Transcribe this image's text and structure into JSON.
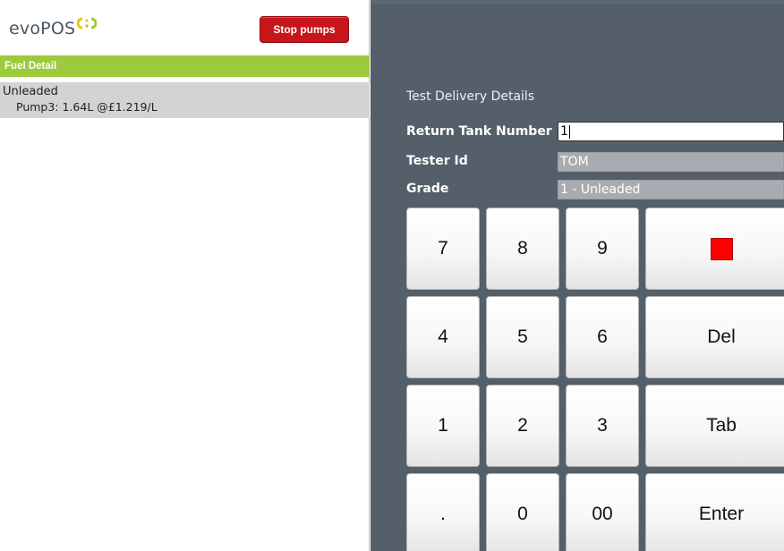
{
  "header": {
    "logo_text": "evoPOS",
    "stop_button_label": "Stop pumps"
  },
  "sidebar": {
    "section_title": "Fuel Detail",
    "items": [
      {
        "grade": "Unleaded",
        "detail": "Pump3: 1.64L @£1.219/L"
      }
    ]
  },
  "form": {
    "title": "Test Delivery Details",
    "fields": [
      {
        "label": "Return Tank Number",
        "value": "1",
        "active": true
      },
      {
        "label": "Tester Id",
        "value": "TOM",
        "active": false
      },
      {
        "label": "Grade",
        "value": "1 - Unleaded",
        "active": false
      }
    ]
  },
  "keypad": {
    "keys": [
      [
        "7",
        "8",
        "9",
        "clear"
      ],
      [
        "4",
        "5",
        "6",
        "Del"
      ],
      [
        "1",
        "2",
        "3",
        "Tab"
      ],
      [
        ".",
        "0",
        "00",
        "Enter"
      ]
    ]
  },
  "colors": {
    "accent_green": "#9cca3c",
    "stop_red": "#c8141b",
    "panel_slate": "#545f69",
    "clear_red": "#ff0000"
  }
}
